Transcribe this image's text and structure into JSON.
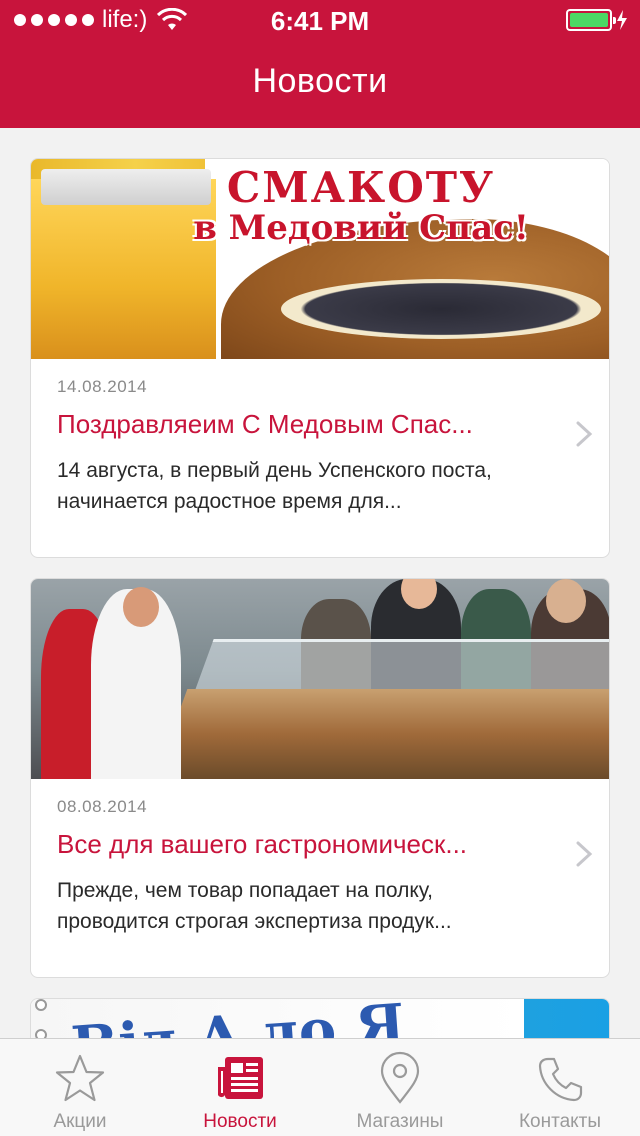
{
  "status_bar": {
    "carrier": "life:)",
    "time": "6:41 PM",
    "battery_color": "#4cd964"
  },
  "header": {
    "title": "Новости",
    "background_color": "#c8143c"
  },
  "news": [
    {
      "banner_line1": "СМАКОТУ",
      "banner_line2": "в Медовий Спас!",
      "date": "14.08.2014",
      "title": "Поздравляеим С Медовым Спас...",
      "text": "14 августа, в первый день Успенского поста, начинается радостное время для..."
    },
    {
      "date": "08.08.2014",
      "title": "Все для вашего гастрономическ...",
      "text": "Прежде, чем товар попадает на полку, проводится строгая экспертиза продук..."
    },
    {
      "banner_text": "Від А до Я"
    }
  ],
  "tabbar": {
    "tabs": [
      {
        "label": "Акции",
        "icon": "star-icon",
        "active": false
      },
      {
        "label": "Новости",
        "icon": "newspaper-icon",
        "active": true
      },
      {
        "label": "Магазины",
        "icon": "map-pin-icon",
        "active": false
      },
      {
        "label": "Контакты",
        "icon": "phone-icon",
        "active": false
      }
    ],
    "active_color": "#c8143c",
    "inactive_color": "#9a9a9a"
  }
}
